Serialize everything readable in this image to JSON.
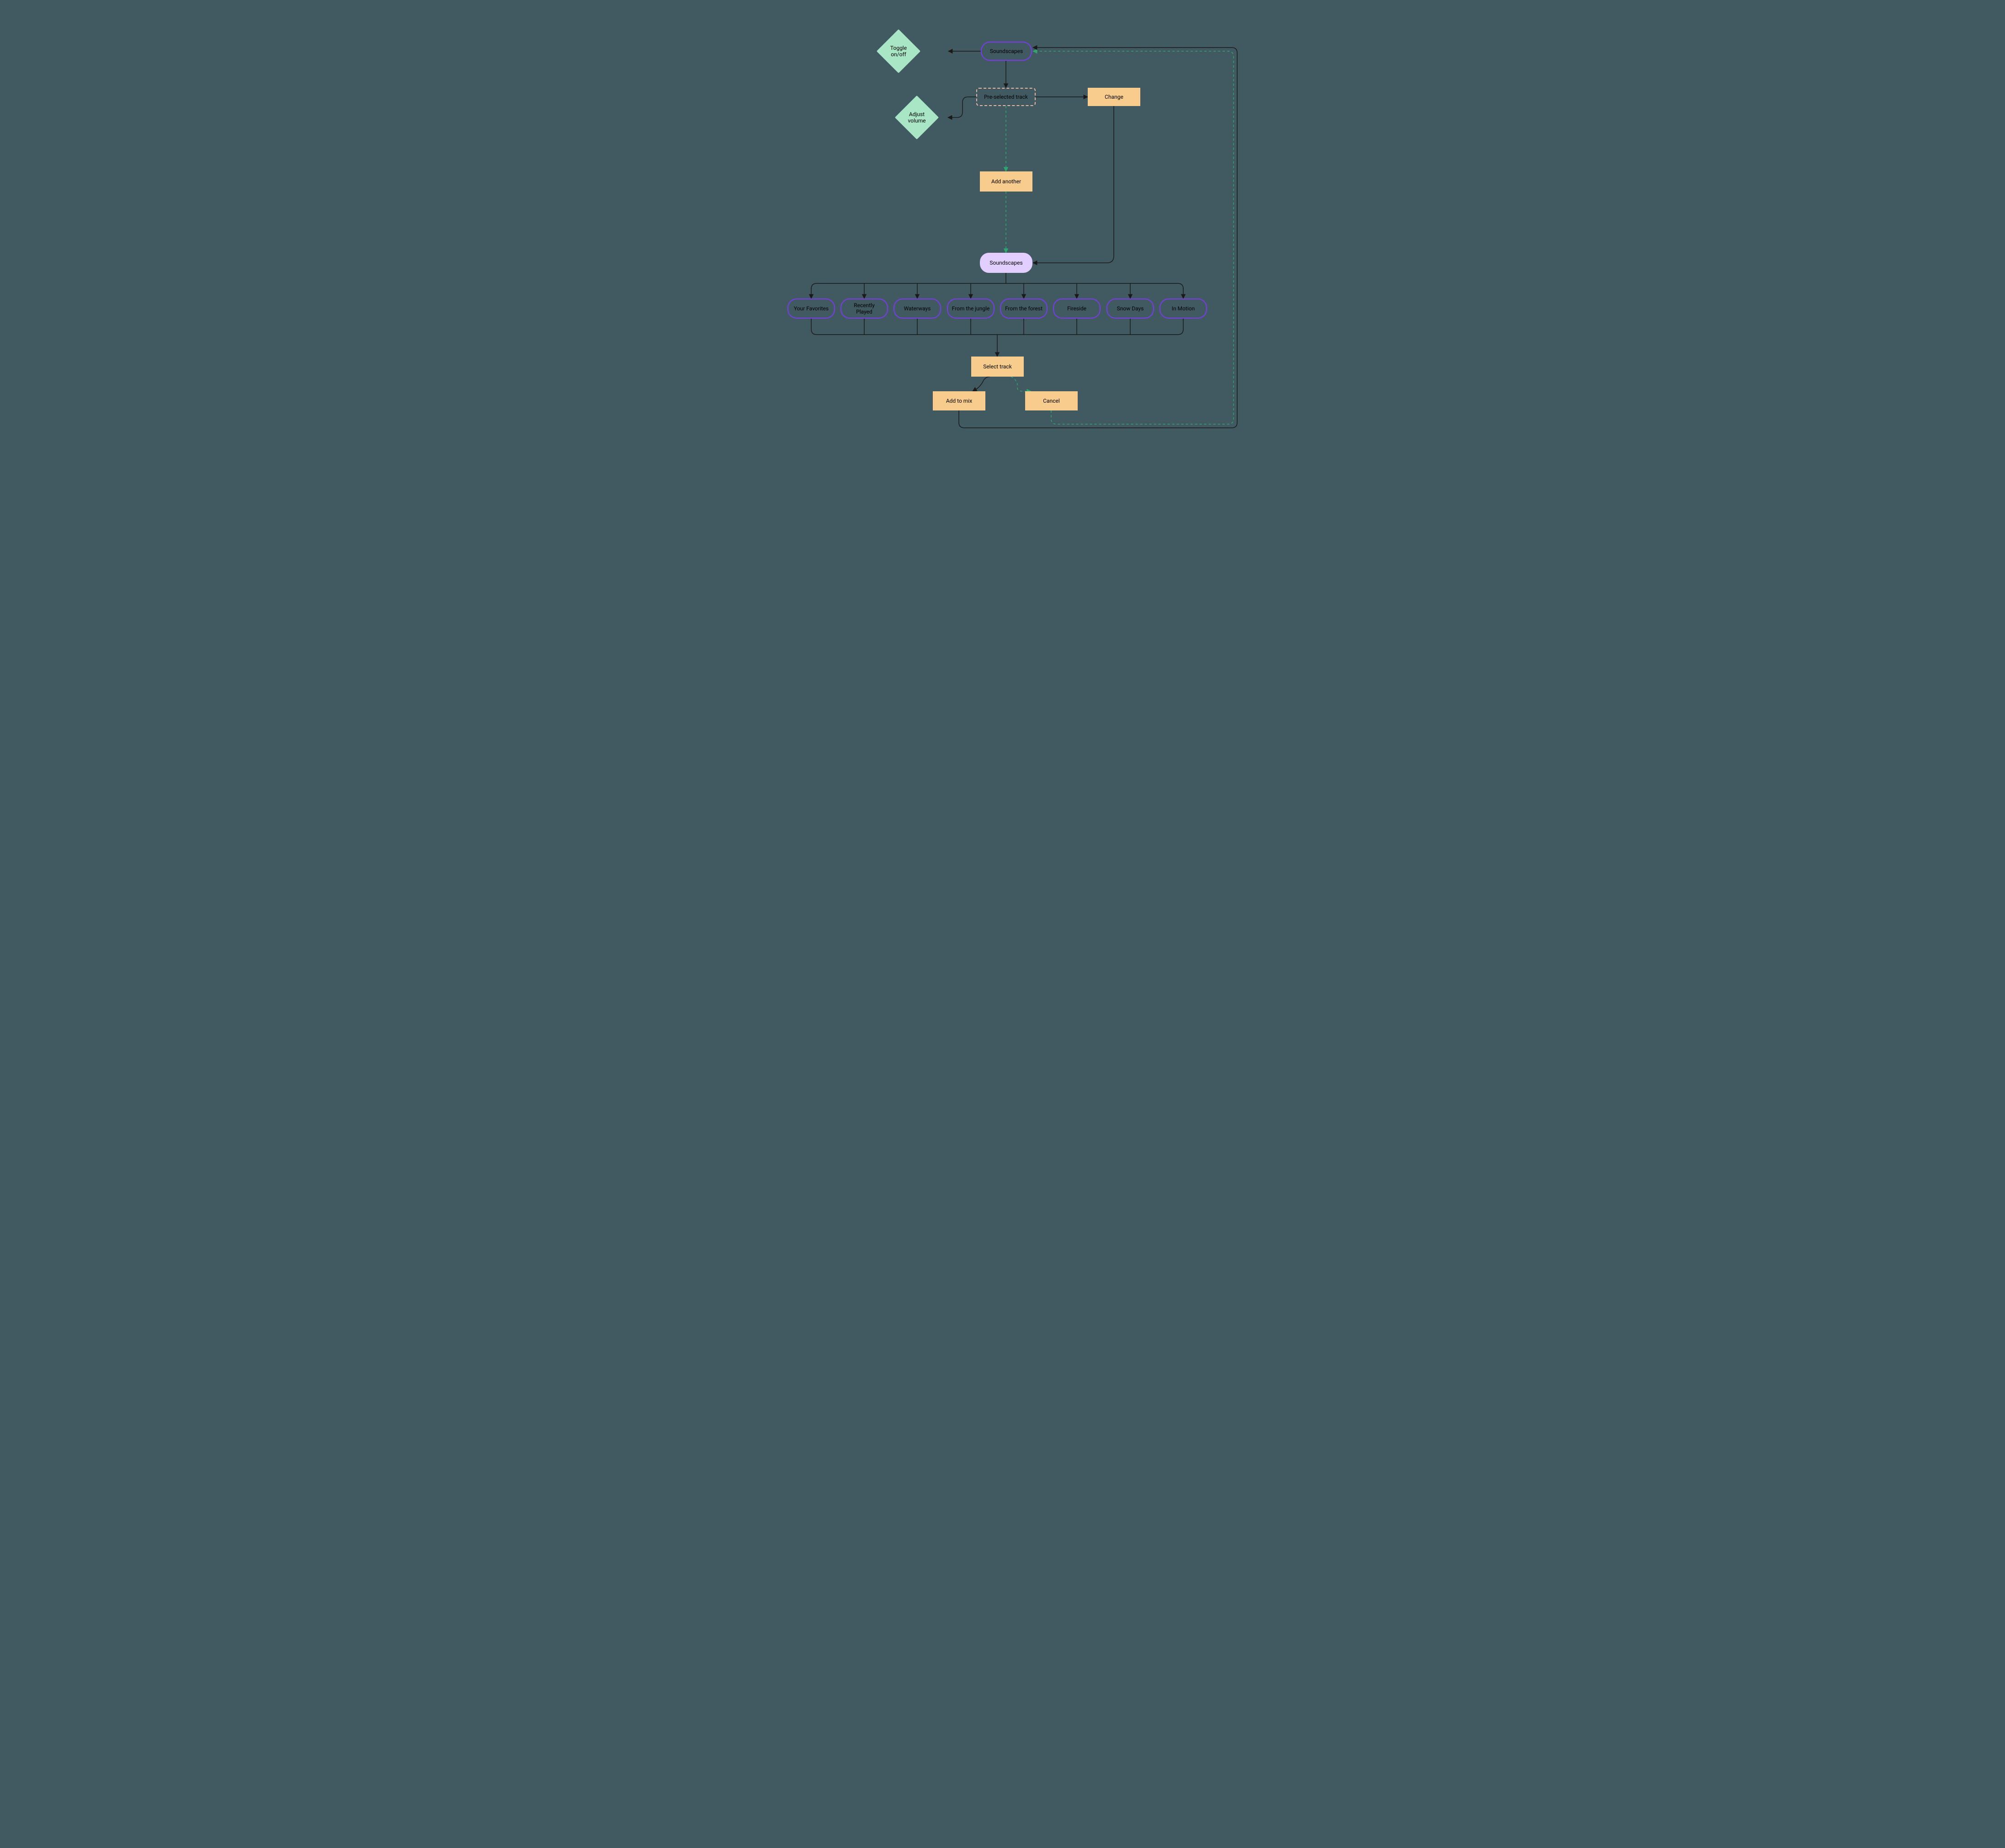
{
  "nodes": {
    "soundscapes_top": "Soundscapes",
    "toggle": "Toggle on/off",
    "preselected": "Pre-selected track",
    "adjust_volume": "Adjust\nvolume",
    "change": "Change",
    "add_another": "Add another",
    "soundscapes_mid": "Soundscapes",
    "select_track": "Select track",
    "add_to_mix": "Add to mix",
    "cancel": "Cancel"
  },
  "categories": [
    "Your Favorites",
    "Recently Played",
    "Waterways",
    "From the jungle",
    "From the forest",
    "Fireside",
    "Snow Days",
    "In Motion"
  ],
  "colors": {
    "bg": "#415A62",
    "purple": "#7C3AED",
    "lilac": "#E2CFFF",
    "mint": "#A8E6C5",
    "peach": "#F7CC8C",
    "edge_black": "#1A1A1A",
    "edge_green": "#2FA66F"
  }
}
